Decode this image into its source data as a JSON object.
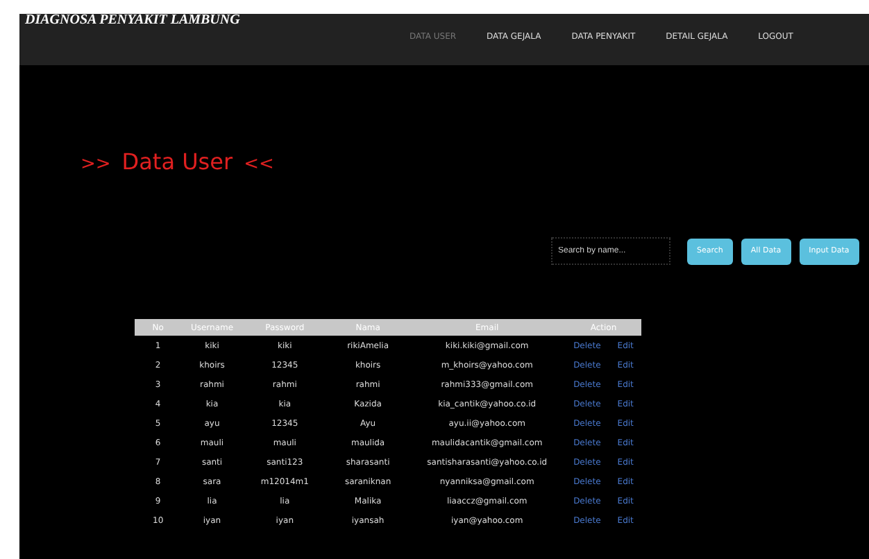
{
  "site_title": "DIAGNOSA PENYAKIT LAMBUNG",
  "nav": [
    {
      "label": "DATA USER",
      "selected": true
    },
    {
      "label": "DATA GEJALA",
      "selected": false
    },
    {
      "label": "DATA PENYAKIT",
      "selected": false
    },
    {
      "label": "DETAIL GEJALA",
      "selected": false
    },
    {
      "label": "LOGOUT",
      "selected": false
    }
  ],
  "heading": {
    "prefix": ">>",
    "title": "Data User",
    "suffix": "<<"
  },
  "search": {
    "placeholder": "Search by name..."
  },
  "buttons": [
    "Search",
    "All Data",
    "Input Data"
  ],
  "table": {
    "columns": [
      "No",
      "Username",
      "Password",
      "Nama",
      "Email",
      "Action"
    ],
    "rows": [
      {
        "cells": [
          "1",
          "kiki",
          "kiki",
          "rikiAmelia",
          "kiki.kiki@gmail.com"
        ],
        "actions": [
          "Delete",
          "Edit"
        ]
      },
      {
        "cells": [
          "2",
          "khoirs",
          "12345",
          "khoirs",
          "m_khoirs@yahoo.com"
        ],
        "actions": [
          "Delete",
          "Edit"
        ]
      },
      {
        "cells": [
          "3",
          "rahmi",
          "rahmi",
          "rahmi",
          "rahmi333@gmail.com"
        ],
        "actions": [
          "Delete",
          "Edit"
        ]
      },
      {
        "cells": [
          "4",
          "kia",
          "kia",
          "Kazida",
          "kia_cantik@yahoo.co.id"
        ],
        "actions": [
          "Delete",
          "Edit"
        ]
      },
      {
        "cells": [
          "5",
          "ayu",
          "12345",
          "Ayu",
          "ayu.ii@yahoo.com"
        ],
        "actions": [
          "Delete",
          "Edit"
        ]
      },
      {
        "cells": [
          "6",
          "mauli",
          "mauli",
          "maulida",
          "maulidacantik@gmail.com"
        ],
        "actions": [
          "Delete",
          "Edit"
        ]
      },
      {
        "cells": [
          "7",
          "santi",
          "santi123",
          "sharasanti",
          "santisharasanti@yahoo.co.id"
        ],
        "actions": [
          "Delete",
          "Edit"
        ]
      },
      {
        "cells": [
          "8",
          "sara",
          "m12014m1",
          "saraniknan",
          "nyanniksa@gmail.com"
        ],
        "actions": [
          "Delete",
          "Edit"
        ]
      },
      {
        "cells": [
          "9",
          "lia",
          "lia",
          "Malika",
          "liaaccz@gmail.com"
        ],
        "actions": [
          "Delete",
          "Edit"
        ]
      },
      {
        "cells": [
          "10",
          "iyan",
          "iyan",
          "iyansah",
          "iyan@yahoo.com"
        ],
        "actions": [
          "Delete",
          "Edit"
        ]
      }
    ]
  }
}
